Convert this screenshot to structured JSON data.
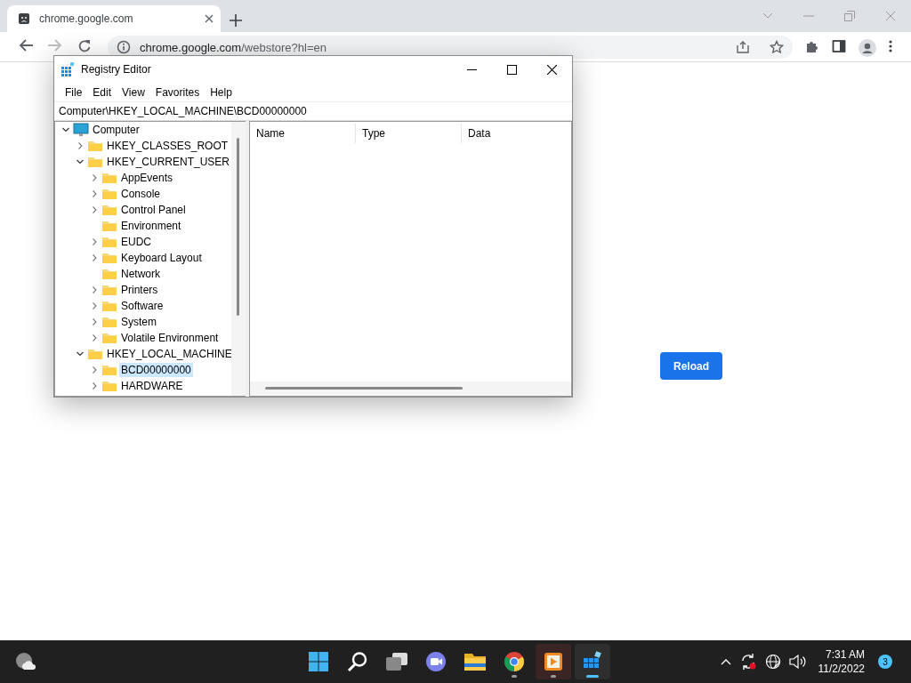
{
  "browser": {
    "tab_title": "chrome.google.com",
    "url_host": "chrome.google.com",
    "url_path": "/webstore?hl=en",
    "forward_disabled": true,
    "reload_button": "Reload"
  },
  "registry_editor": {
    "title": "Registry Editor",
    "menu": [
      "File",
      "Edit",
      "View",
      "Favorites",
      "Help"
    ],
    "address": "Computer\\HKEY_LOCAL_MACHINE\\BCD00000000",
    "tree": [
      {
        "label": "Computer",
        "kind": "computer",
        "expandable": true,
        "expanded": true,
        "selected": false,
        "children": [
          {
            "label": "HKEY_CLASSES_ROOT",
            "kind": "folder",
            "expandable": true,
            "expanded": false,
            "selected": false
          },
          {
            "label": "HKEY_CURRENT_USER",
            "kind": "folder",
            "expandable": true,
            "expanded": true,
            "selected": false,
            "children": [
              {
                "label": "AppEvents",
                "kind": "folder",
                "expandable": true,
                "expanded": false,
                "selected": false
              },
              {
                "label": "Console",
                "kind": "folder",
                "expandable": true,
                "expanded": false,
                "selected": false
              },
              {
                "label": "Control Panel",
                "kind": "folder",
                "expandable": true,
                "expanded": false,
                "selected": false
              },
              {
                "label": "Environment",
                "kind": "folder",
                "expandable": false,
                "expanded": false,
                "selected": false
              },
              {
                "label": "EUDC",
                "kind": "folder",
                "expandable": true,
                "expanded": false,
                "selected": false
              },
              {
                "label": "Keyboard Layout",
                "kind": "folder",
                "expandable": true,
                "expanded": false,
                "selected": false
              },
              {
                "label": "Network",
                "kind": "folder",
                "expandable": false,
                "expanded": false,
                "selected": false
              },
              {
                "label": "Printers",
                "kind": "folder",
                "expandable": true,
                "expanded": false,
                "selected": false
              },
              {
                "label": "Software",
                "kind": "folder",
                "expandable": true,
                "expanded": false,
                "selected": false
              },
              {
                "label": "System",
                "kind": "folder",
                "expandable": true,
                "expanded": false,
                "selected": false
              },
              {
                "label": "Volatile Environment",
                "kind": "folder",
                "expandable": true,
                "expanded": false,
                "selected": false
              }
            ]
          },
          {
            "label": "HKEY_LOCAL_MACHINE",
            "kind": "folder",
            "expandable": true,
            "expanded": true,
            "selected": false,
            "children": [
              {
                "label": "BCD00000000",
                "kind": "folder",
                "expandable": true,
                "expanded": false,
                "selected": true
              },
              {
                "label": "HARDWARE",
                "kind": "folder",
                "expandable": true,
                "expanded": false,
                "selected": false
              }
            ]
          }
        ]
      }
    ],
    "columns": [
      "Name",
      "Type",
      "Data"
    ]
  },
  "taskbar": {
    "apps": [
      {
        "kind": "start",
        "running": false,
        "active": false,
        "hovered": false
      },
      {
        "kind": "search",
        "running": false,
        "active": false,
        "hovered": false
      },
      {
        "kind": "taskview",
        "running": false,
        "active": false,
        "hovered": false
      },
      {
        "kind": "chat",
        "running": false,
        "active": false,
        "hovered": false
      },
      {
        "kind": "explorer",
        "running": false,
        "active": false,
        "hovered": false
      },
      {
        "kind": "chrome",
        "running": true,
        "active": false,
        "hovered": false
      },
      {
        "kind": "media",
        "running": true,
        "active": false,
        "hovered": true
      },
      {
        "kind": "regedit",
        "running": true,
        "active": true,
        "hovered": false
      }
    ],
    "time": "7:31 AM",
    "date": "11/2/2022",
    "notification_count": "3"
  }
}
